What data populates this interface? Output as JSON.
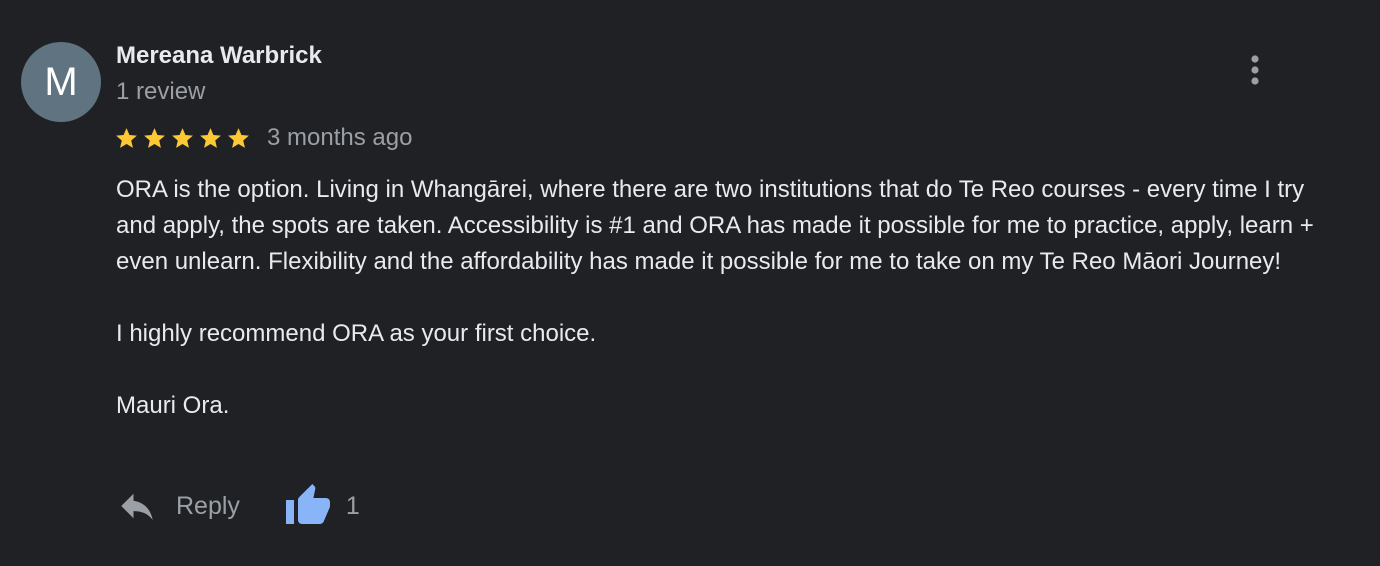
{
  "reviewer": {
    "initial": "M",
    "name": "Mereana Warbrick",
    "review_count": "1 review",
    "avatar_color": "#5f7381"
  },
  "rating": {
    "stars": 5,
    "max": 5,
    "star_color": "#fcc934"
  },
  "date": "3 months ago",
  "text": {
    "paragraph1": "ORA is the option. Living in Whangārei, where there are two institutions that do Te Reo courses - every time I try and apply, the spots are taken. Accessibility is #1 and ORA has made it possible for me to practice, apply, learn + even unlearn. Flexibility and the affordability has made it possible for me to take on my Te Reo Māori Journey!",
    "paragraph2": "I highly recommend ORA as your first choice.",
    "paragraph3": "Mauri Ora."
  },
  "actions": {
    "reply_label": "Reply",
    "reply_icon": "reply-arrow-icon",
    "like_icon": "thumbs-up-icon",
    "like_count": "1",
    "like_color": "#8ab4f8"
  },
  "menu_icon": "more-vert-icon"
}
